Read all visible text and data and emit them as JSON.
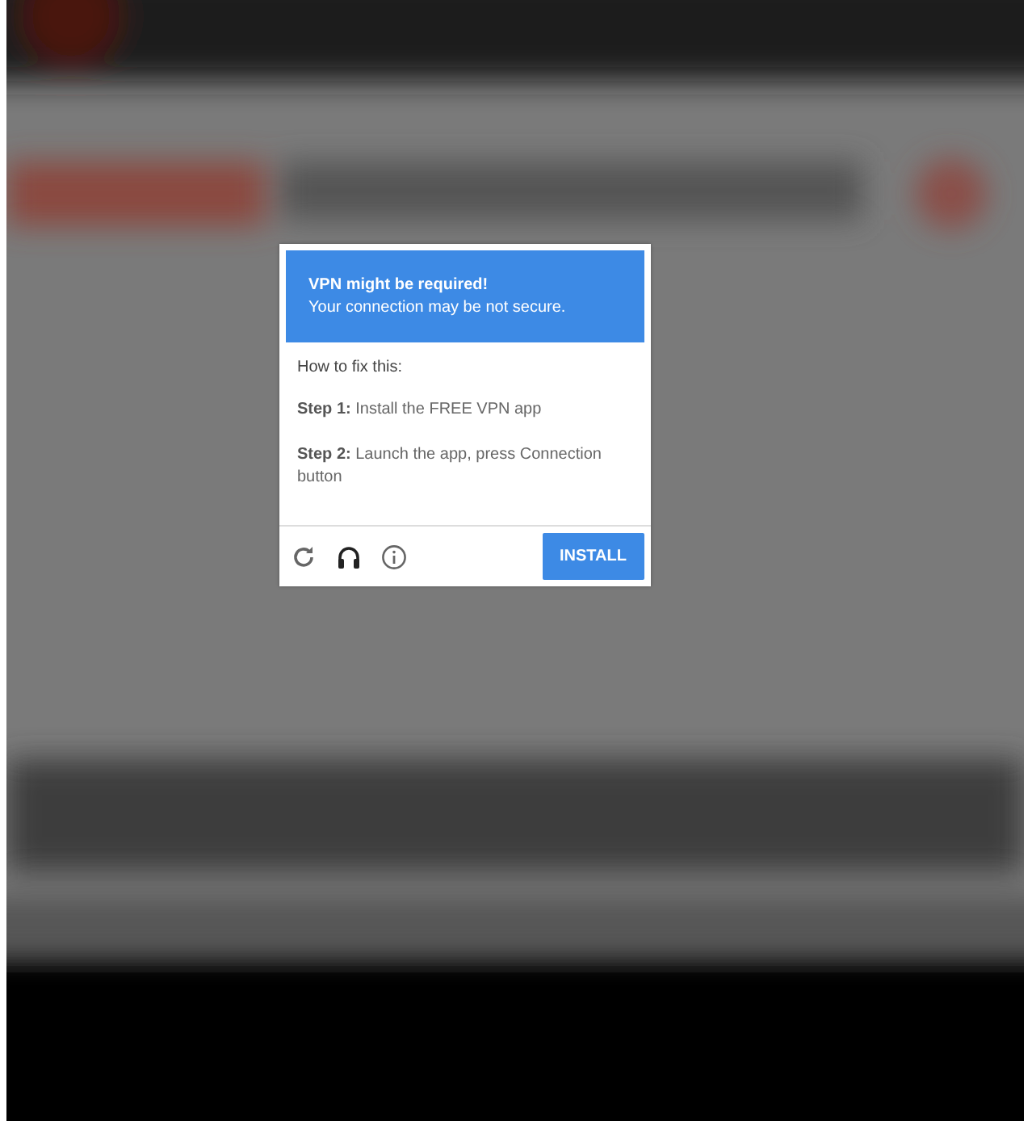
{
  "dialog": {
    "title": "VPN might be required!",
    "subtitle": "Your connection may be not secure.",
    "heading": "How to fix this:",
    "steps": [
      {
        "label": "Step 1:",
        "text": "Install the FREE VPN app"
      },
      {
        "label": "Step 2:",
        "text": "Launch the app, press Connection button"
      }
    ],
    "footer_icons": [
      {
        "kind": "refresh"
      },
      {
        "kind": "headphones"
      },
      {
        "kind": "info"
      }
    ],
    "button": "INSTALL"
  }
}
